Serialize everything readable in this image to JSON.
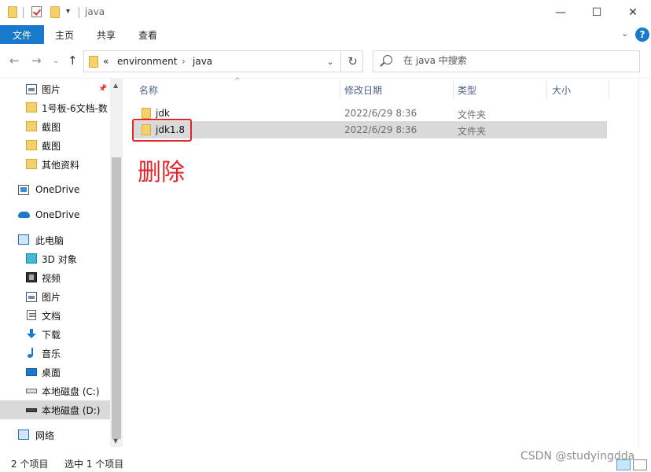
{
  "window": {
    "title": "java",
    "controls": {
      "minimize": "—",
      "maximize": "☐",
      "close": "✕"
    }
  },
  "ribbon": {
    "tabs": [
      "文件",
      "主页",
      "共享",
      "查看"
    ],
    "expand_icon": "chevron-down",
    "help_label": "?"
  },
  "address": {
    "crumb_prefix": "«",
    "crumbs": [
      "environment",
      "java"
    ],
    "separator": "›"
  },
  "search": {
    "placeholder": "在 java 中搜索"
  },
  "sidebar": {
    "items": [
      {
        "label": "图片",
        "icon": "picture-icon",
        "pinned": true
      },
      {
        "label": "1号板-6文档-数",
        "icon": "folder-icon"
      },
      {
        "label": "截图",
        "icon": "folder-icon"
      },
      {
        "label": "截图",
        "icon": "folder-icon"
      },
      {
        "label": "其他资料",
        "icon": "folder-icon"
      },
      {
        "label": "OneDrive",
        "icon": "onedrive-icon"
      },
      {
        "label": "OneDrive",
        "icon": "cloud-icon"
      },
      {
        "label": "此电脑",
        "icon": "pc-icon"
      },
      {
        "label": "3D 对象",
        "icon": "3d-objects-icon"
      },
      {
        "label": "视频",
        "icon": "video-icon"
      },
      {
        "label": "图片",
        "icon": "picture-icon"
      },
      {
        "label": "文档",
        "icon": "document-icon"
      },
      {
        "label": "下载",
        "icon": "download-icon"
      },
      {
        "label": "音乐",
        "icon": "music-icon"
      },
      {
        "label": "桌面",
        "icon": "desktop-icon"
      },
      {
        "label": "本地磁盘 (C:)",
        "icon": "drive-icon"
      },
      {
        "label": "本地磁盘 (D:)",
        "icon": "drive-icon",
        "selected": true
      },
      {
        "label": "网络",
        "icon": "network-icon"
      }
    ]
  },
  "columns": [
    "名称",
    "修改日期",
    "类型",
    "大小"
  ],
  "files": [
    {
      "name": "jdk",
      "modified": "2022/6/29 8:36",
      "type": "文件夹",
      "size": ""
    },
    {
      "name": "jdk1.8",
      "modified": "2022/6/29 8:36",
      "type": "文件夹",
      "size": "",
      "selected": true
    }
  ],
  "annotation": {
    "text": "删除",
    "color": "#e4242b"
  },
  "status": {
    "item_count": "2 个项目",
    "selection": "选中 1 个项目"
  },
  "watermark": "CSDN @studyingdda",
  "colors": {
    "accent": "#1979ca",
    "selection": "#d9d9d9",
    "annotation": "#e4242b"
  }
}
